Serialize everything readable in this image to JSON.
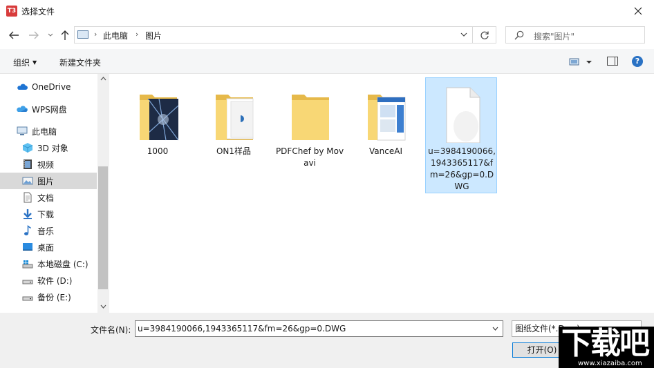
{
  "window": {
    "app_icon": "T3",
    "title": "选择文件"
  },
  "navigation": {
    "breadcrumb": [
      "此电脑",
      "图片"
    ],
    "search_placeholder": "搜索\"图片\""
  },
  "toolbar": {
    "organize_label": "组织",
    "new_folder_label": "新建文件夹"
  },
  "sidebar": {
    "items": [
      {
        "label": "OneDrive",
        "icon": "onedrive-icon"
      },
      {
        "label": "WPS网盘",
        "icon": "wps-cloud-icon"
      },
      {
        "label": "此电脑",
        "icon": "this-pc-icon"
      },
      {
        "label": "3D 对象",
        "icon": "3d-objects-icon"
      },
      {
        "label": "视频",
        "icon": "video-icon"
      },
      {
        "label": "图片",
        "icon": "pictures-icon",
        "selected": true
      },
      {
        "label": "文档",
        "icon": "documents-icon"
      },
      {
        "label": "下载",
        "icon": "download-icon"
      },
      {
        "label": "音乐",
        "icon": "music-icon"
      },
      {
        "label": "桌面",
        "icon": "desktop-icon"
      },
      {
        "label": "本地磁盘 (C:)",
        "icon": "local-disk-icon"
      },
      {
        "label": "软件 (D:)",
        "icon": "drive-icon"
      },
      {
        "label": "备份 (E:)",
        "icon": "drive-icon"
      }
    ]
  },
  "files": [
    {
      "name": "1000",
      "type": "folder"
    },
    {
      "name": "ON1样品",
      "type": "folder"
    },
    {
      "name": "PDFChef by Movavi",
      "type": "folder"
    },
    {
      "name": "VanceAI",
      "type": "folder"
    },
    {
      "name": "u=3984190066,1943365117&fm=26&gp=0.DWG",
      "type": "file",
      "selected": true
    }
  ],
  "footer": {
    "filename_label": "文件名(N):",
    "filename_value": "u=3984190066,1943365117&fm=26&gp=0.DWG",
    "filetype_value": "图纸文件(*.Dwg)",
    "open_label": "打开(O)"
  },
  "watermark": {
    "text": "下载吧",
    "url": "www.xiazaiba.com"
  },
  "colors": {
    "selection": "#cce8ff",
    "accent": "#0078d7",
    "folder": "#f8d775"
  }
}
